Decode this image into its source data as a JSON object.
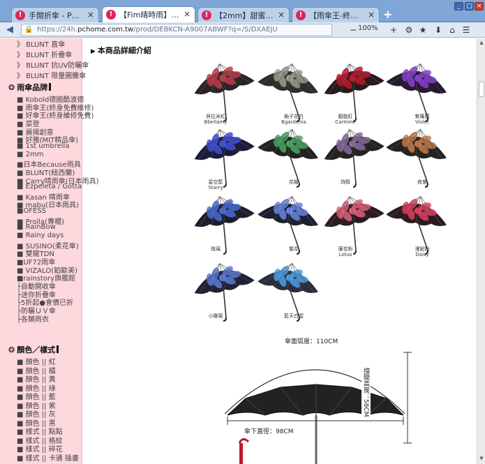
{
  "tabs": [
    {
      "label": "手開折傘 - PChome 24h…",
      "active": false
    },
    {
      "label": "【Fim晴時雨】晴雨兩用…",
      "active": true
    },
    {
      "label": "【2mm】甜蜜夢境★魔…",
      "active": false
    },
    {
      "label": "【雨傘王-終身免費維修…",
      "active": false
    }
  ],
  "new_tab_label": "+",
  "address": {
    "prefix": "https://24h.",
    "domain": "pchome.com.tw",
    "path": "/prod/DEBKCN-A9007ABWF?q=/S/DXAEJU"
  },
  "zoom_level": "100%",
  "sidebar": {
    "top_items": [
      "》 BLUNT 直傘",
      "》 BLUNT 折疊傘",
      "》 BLUNT 抗UV防曬傘",
      "》 BLUNT 限量圖騰傘"
    ],
    "brand_heading": "雨傘品牌",
    "brands": [
      "■ Kobold德國酷波德",
      "■ 雨傘王(終身免費維修)",
      "■ 好傘王(終身維修免費)",
      "■ 菜登",
      "■ 晨揚創意",
      "■ 好雅(MIT精品傘)",
      "■ 1st umbrella",
      "■ 2mm",
      "■日本Because雨具",
      "■ BLUNT(紐西蘭)",
      "■ Carry晴雨傘(日本雨具)",
      "■ Ezpeleta / Gotta",
      "■ Kasan 晴雨傘",
      "■ mabu(日本雨具)",
      "■OFESS",
      "■ Prolla(專櫃)",
      "■ RainBow",
      "■ Rainy days",
      "■ SUSINO(柔花傘)",
      "■ 雙龍TDN",
      "■UF72雨傘",
      "■ VIZALO(鉑歐美)",
      "■rainstory旗艦館",
      "├自動開收傘",
      "├迷你折疊傘",
      "├5折起●會價已折",
      "├防曬ＵＶ傘",
      "├各類雨衣"
    ],
    "color_heading": "顏色／樣式",
    "colors": [
      "■ 顏色 || 紅",
      "■ 顏色 || 橘",
      "■ 顏色 || 黃",
      "■ 顏色 || 綠",
      "■ 顏色 || 藍",
      "■ 顏色 || 紫",
      "■ 顏色 || 灰",
      "■ 顏色 || 黑",
      "■ 樣式 || 點點",
      "■ 樣式 || 格紋",
      "■ 樣式 || 碎花",
      "■ 樣式 || 卡通 插畫"
    ]
  },
  "main": {
    "section_title": "本商品詳細介紹",
    "umbrellas": [
      {
        "name": "貝拉米紅",
        "en": "Bbellamy",
        "canopy": "#2b2427",
        "pattern": "#c23a4a"
      },
      {
        "name": "梔子花白",
        "en": "Bgardenia",
        "canopy": "#2e2d2c",
        "pattern": "#9aa08e"
      },
      {
        "name": "胭脂紅",
        "en": "Carmine",
        "canopy": "#2a1a1c",
        "pattern": "#c0162a"
      },
      {
        "name": "紫羅蘭",
        "en": "Violet",
        "canopy": "#261a30",
        "pattern": "#8a3fd0"
      },
      {
        "name": "星空藍",
        "en": "Starry",
        "canopy": "#1a1c3a",
        "pattern": "#3d4fd8"
      },
      {
        "name": "花瓣",
        "en": "",
        "canopy": "#222222",
        "pattern": "#4aa564"
      },
      {
        "name": "詩醇",
        "en": "",
        "canopy": "#222222",
        "pattern": "#8a6aa0"
      },
      {
        "name": "夜鶯",
        "en": "",
        "canopy": "#252322",
        "pattern": "#c47a4a"
      },
      {
        "name": "琉璃",
        "en": "",
        "canopy": "#1c1e2c",
        "pattern": "#4a6ad8"
      },
      {
        "name": "繁花",
        "en": "",
        "canopy": "#1d2030",
        "pattern": "#6a86e8"
      },
      {
        "name": "蓮花粉",
        "en": "Lotus",
        "canopy": "#2a1c22",
        "pattern": "#e0607a"
      },
      {
        "name": "漫妮粉",
        "en": "Daisy",
        "canopy": "#2b1a20",
        "pattern": "#e0405e"
      },
      {
        "name": "小雛菊",
        "en": "",
        "canopy": "#1e2232",
        "pattern": "#5b7ad8"
      },
      {
        "name": "藍天白雲",
        "en": "",
        "canopy": "#2a2f40",
        "pattern": "#4aa0e8"
      }
    ],
    "spec": {
      "arc_label": "傘面弧度：110CM",
      "height_label": "撐開高度：58CM",
      "diameter_label": "傘下直徑：98CM"
    }
  }
}
